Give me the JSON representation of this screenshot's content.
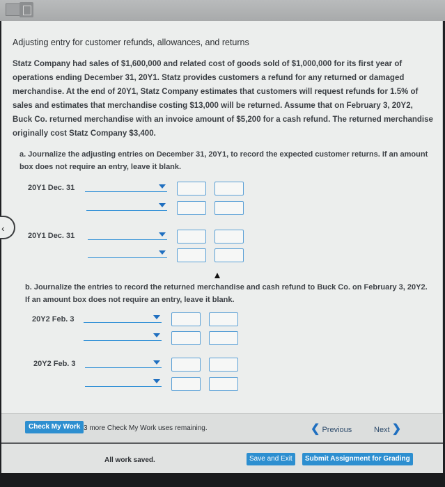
{
  "title": "Adjusting entry for customer refunds, allowances, and returns",
  "paragraph": "Statz Company had sales of $1,600,000 and related cost of goods sold of $1,000,000 for its first year of operations ending December 31, 20Y1. Statz provides customers a refund for any returned or damaged merchandise. At the end of 20Y1, Statz Company estimates that customers will request refunds for 1.5% of sales and estimates that merchandise costing $13,000 will be returned. Assume that on February 3, 20Y2, Buck Co. returned merchandise with an invoice amount of $5,200 for a cash refund. The returned merchandise originally cost Statz Company $3,400.",
  "part_a": {
    "label": "a.",
    "text": "Journalize the adjusting entries on December 31, 20Y1, to record the expected customer returns. If an amount box does not require an entry, leave it blank.",
    "entries": [
      {
        "date": "20Y1 Dec. 31"
      },
      {
        "date": "20Y1 Dec. 31"
      }
    ]
  },
  "part_b": {
    "label": "b.",
    "text": "Journalize the entries to record the returned merchandise and cash refund to Buck Co. on February 3, 20Y2. If an amount box does not require an entry, leave it blank.",
    "entries": [
      {
        "date": "20Y2 Feb. 3"
      },
      {
        "date": "20Y2 Feb. 3"
      }
    ]
  },
  "check_my_work": "Check My Work",
  "remaining": "3 more Check My Work uses remaining.",
  "previous": "Previous",
  "next": "Next",
  "status": "All work saved.",
  "save_exit": "Save and Exit",
  "submit": "Submit Assignment for Grading",
  "colors": {
    "accent": "#2d8fd0",
    "link": "#1f6fc0"
  }
}
